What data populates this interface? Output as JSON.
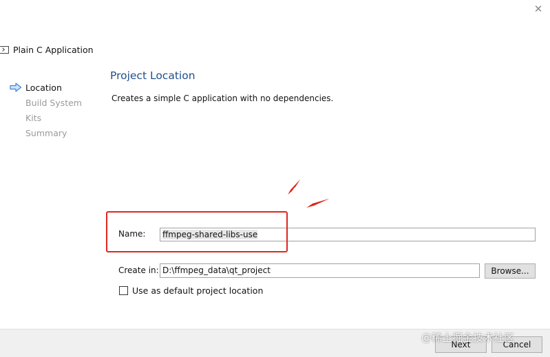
{
  "window": {
    "close_glyph": "✕"
  },
  "wizard": {
    "title": "Plain C Application",
    "app_icon": "console-app-icon"
  },
  "steps": [
    {
      "label": "Location",
      "state": "current"
    },
    {
      "label": "Build System",
      "state": "pending"
    },
    {
      "label": "Kits",
      "state": "pending"
    },
    {
      "label": "Summary",
      "state": "pending"
    }
  ],
  "page": {
    "heading": "Project Location",
    "description": "Creates a simple C application with no dependencies."
  },
  "form": {
    "name_label": "Name:",
    "name_value": "ffmpeg-shared-libs-use",
    "createin_label": "Create in:",
    "createin_value": "D:\\ffmpeg_data\\qt_project",
    "browse_label": "Browse...",
    "default_location_label": "Use as default project location",
    "default_location_checked": false
  },
  "buttons": {
    "next_label": "Next",
    "cancel_label": "Cancel"
  },
  "watermark": "@稀土掘金技术社区",
  "colors": {
    "heading": "#1f4f8c",
    "annotation_red": "#e0251d",
    "step_arrow": "#3f82d6"
  }
}
